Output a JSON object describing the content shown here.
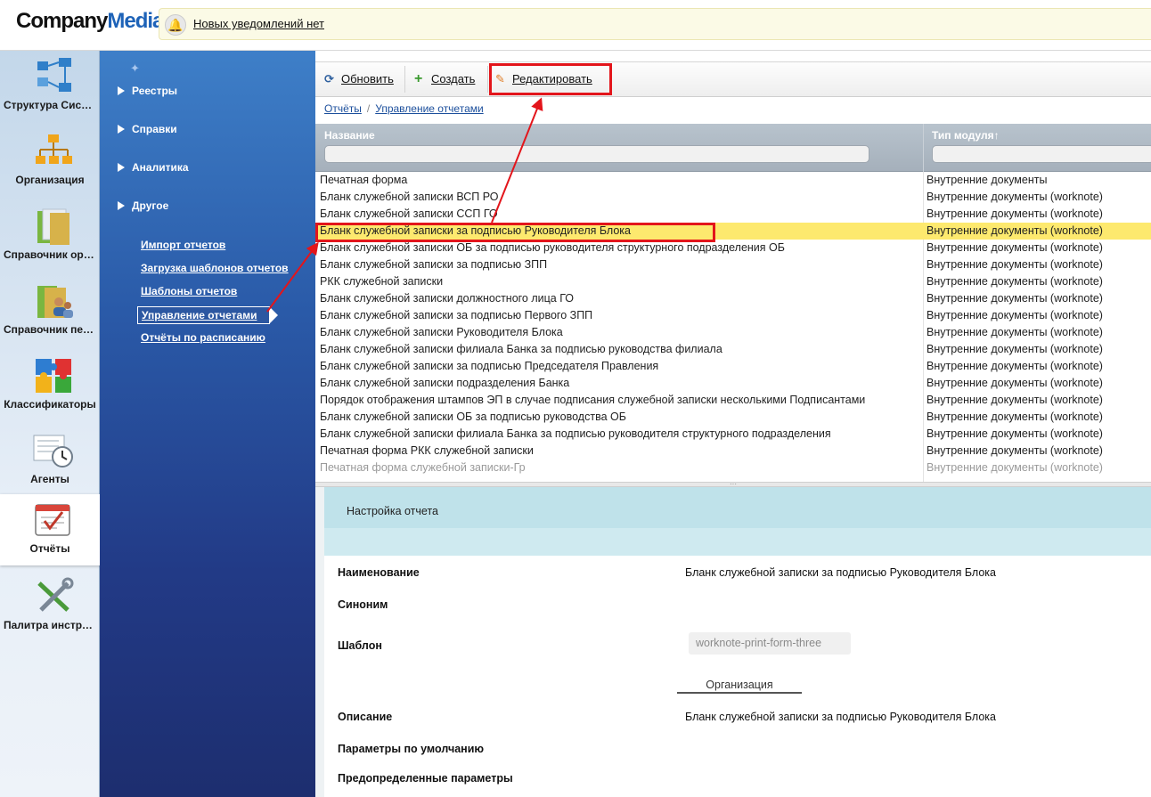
{
  "header": {
    "logo_part1": "Company",
    "logo_part2": "Media",
    "notification_text": "Новых уведомлений нет",
    "bell_glyph": "🔔"
  },
  "modules": [
    {
      "label": "Структура Сист…",
      "icon": "network-structure-icon"
    },
    {
      "label": "Организация",
      "icon": "org-chart-icon"
    },
    {
      "label": "Справочник орг…",
      "icon": "folder-icon"
    },
    {
      "label": "Справочник пер…",
      "icon": "people-folder-icon"
    },
    {
      "label": "Классификаторы",
      "icon": "puzzle-icon"
    },
    {
      "label": "Агенты",
      "icon": "clock-document-icon"
    },
    {
      "label": "Отчёты",
      "icon": "report-icon",
      "active": true
    },
    {
      "label": "Палитра инстру…",
      "icon": "tools-icon"
    }
  ],
  "nav": {
    "pin_glyph": "✦",
    "sections": [
      "Реестры",
      "Справки",
      "Аналитика",
      "Другое"
    ],
    "links": [
      "Импорт отчетов",
      "Загрузка шаблонов отчетов",
      "Шаблоны отчетов",
      "Управление отчетами",
      "Отчёты по расписанию"
    ],
    "active_link_index": 3
  },
  "toolbar": {
    "refresh_glyph": "⟳",
    "refresh_label": "Обновить",
    "create_glyph": "+",
    "create_label": "Создать",
    "edit_glyph": "✎",
    "edit_label": "Редактировать"
  },
  "breadcrumb": {
    "root": "Отчёты",
    "separator": "/",
    "current": "Управление отчетами"
  },
  "grid": {
    "col_name": "Название",
    "col_type": "Тип модуля↑",
    "rows": [
      {
        "name": "Печатная форма",
        "type": "Внутренние документы"
      },
      {
        "name": "Бланк служебной записки ВСП РО",
        "type": "Внутренние документы (worknote)"
      },
      {
        "name": "Бланк служебной записки ССП ГО",
        "type": "Внутренние документы (worknote)"
      },
      {
        "name": "Бланк служебной записки за подписью Руководителя Блока",
        "type": "Внутренние документы (worknote)",
        "selected": true
      },
      {
        "name": "Бланк служебной записки ОБ за подписью руководителя структурного подразделения ОБ",
        "type": "Внутренние документы (worknote)"
      },
      {
        "name": "Бланк служебной записки за подписью ЗПП",
        "type": "Внутренние документы (worknote)"
      },
      {
        "name": "РКК служебной записки",
        "type": "Внутренние документы (worknote)"
      },
      {
        "name": "Бланк служебной записки должностного лица ГО",
        "type": "Внутренние документы (worknote)"
      },
      {
        "name": "Бланк служебной записки за подписью Первого ЗПП",
        "type": "Внутренние документы (worknote)"
      },
      {
        "name": "Бланк служебной записки Руководителя Блока",
        "type": "Внутренние документы (worknote)"
      },
      {
        "name": "Бланк служебной записки филиала Банка за подписью руководства филиала",
        "type": "Внутренние документы (worknote)"
      },
      {
        "name": "Бланк служебной записки за подписью Председателя Правления",
        "type": "Внутренние документы (worknote)"
      },
      {
        "name": "Бланк служебной записки подразделения Банка",
        "type": "Внутренние документы (worknote)"
      },
      {
        "name": "Порядок отображения штампов ЭП в случае подписания служебной записки несколькими Подписантами",
        "type": "Внутренние документы (worknote)"
      },
      {
        "name": "Бланк служебной записки ОБ за подписью руководства ОБ",
        "type": "Внутренние документы (worknote)"
      },
      {
        "name": "Бланк служебной записки филиала Банка за подписью руководителя структурного подразделения",
        "type": "Внутренние документы (worknote)"
      },
      {
        "name": "Печатная форма РКК служебной записки",
        "type": "Внутренние документы (worknote)"
      },
      {
        "name": "Печатная форма служебной записки-Гр",
        "type": "Внутренние документы (worknote)",
        "faded": true
      }
    ],
    "splitter_glyph": "···"
  },
  "form": {
    "title": "Настройка отчета",
    "name_label": "Наименование",
    "name_value": "Бланк служебной записки за подписью Руководителя Блока",
    "synonym_label": "Синоним",
    "template_label": "Шаблон",
    "template_value": "worknote-print-form-three",
    "org_tab": "Организация",
    "description_label": "Описание",
    "description_value": "Бланк служебной записки за подписью Руководителя Блока",
    "defaults_label": "Параметры по умолчанию",
    "predefined_label": "Предопределенные параметры"
  },
  "colors": {
    "accent": "#1e63b8",
    "selected_row": "#fde96e",
    "highlight": "#e3151b"
  }
}
